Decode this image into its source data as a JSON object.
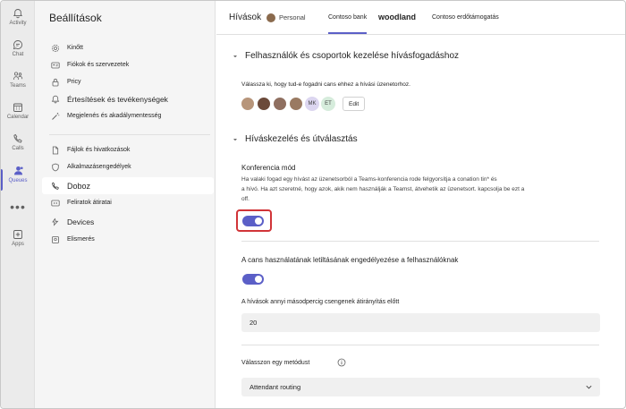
{
  "rail": {
    "items": [
      {
        "label": "Activity",
        "icon": "bell-icon"
      },
      {
        "label": "Chat",
        "icon": "chat-icon"
      },
      {
        "label": "Teams",
        "icon": "teams-icon"
      },
      {
        "label": "Calendar",
        "icon": "calendar-icon"
      },
      {
        "label": "Calls",
        "icon": "phone-icon"
      },
      {
        "label": "Queues",
        "icon": "queues-icon"
      },
      {
        "label": "Apps",
        "icon": "apps-icon"
      }
    ],
    "more": "•••"
  },
  "sidebar": {
    "title": "Beállítások",
    "items": [
      {
        "label": "Kinőtt",
        "icon": "gear-icon"
      },
      {
        "label": "Fiókok és szervezetek",
        "icon": "id-card-icon"
      },
      {
        "label": "Pricy",
        "icon": "lock-icon"
      },
      {
        "label": "Értesítések és tevékenységek",
        "icon": "bell-icon"
      },
      {
        "label": "Megjelenés és akadálymentesség",
        "icon": "wand-icon"
      },
      {
        "label": "Fájlok és hivatkozások",
        "icon": "document-icon"
      },
      {
        "label": "Alkalmazásengedélyek",
        "icon": "shield-icon"
      },
      {
        "label": "Doboz",
        "icon": "phone-icon"
      },
      {
        "label": "Feliratok átiratai",
        "icon": "captions-icon"
      },
      {
        "label": "Devices",
        "icon": "devices-icon"
      },
      {
        "label": "Elismerés",
        "icon": "ribbon-icon"
      }
    ]
  },
  "header": {
    "title": "Hívások",
    "personal": "Personal",
    "tabs": [
      "Contoso bank",
      "woodland",
      "Contoso erdőtámogatás"
    ]
  },
  "main": {
    "section1": {
      "title": "Felhasználók és csoportok kezelése hívásfogadáshoz",
      "desc": "Válassza ki, hogy tud-e fogadni cans ehhez a hívási üzenetorhoz.",
      "avatars": [
        "MK",
        "ET"
      ],
      "edit": "Edit"
    },
    "section2": {
      "title": "Híváskezelés és útválasztás",
      "conf_label": "Konferencia mód",
      "conf_desc1": "Ha valaki fogad egy hívást az üzenetsorból a Teams-konferencia rode felgyorsítja a conation tin* és",
      "conf_desc2": "a hívó. Ha azt szeretné, hogy azok, akik nem használják a Teamst, átvehetik az üzenetsort. kapcsolja be ezt a",
      "conf_desc3": "off.",
      "opt_out_label": "A cans használatának letiltásának engedélyezése a felhasználóknak",
      "seconds_label": "A hívások annyi másodpercig csengenek átirányítás előtt",
      "seconds_value": "20",
      "method_label": "Válasszon egy metódust",
      "method_value": "Attendant routing"
    }
  },
  "colors": {
    "accent": "#5b5fc7",
    "highlight": "#d13438"
  }
}
